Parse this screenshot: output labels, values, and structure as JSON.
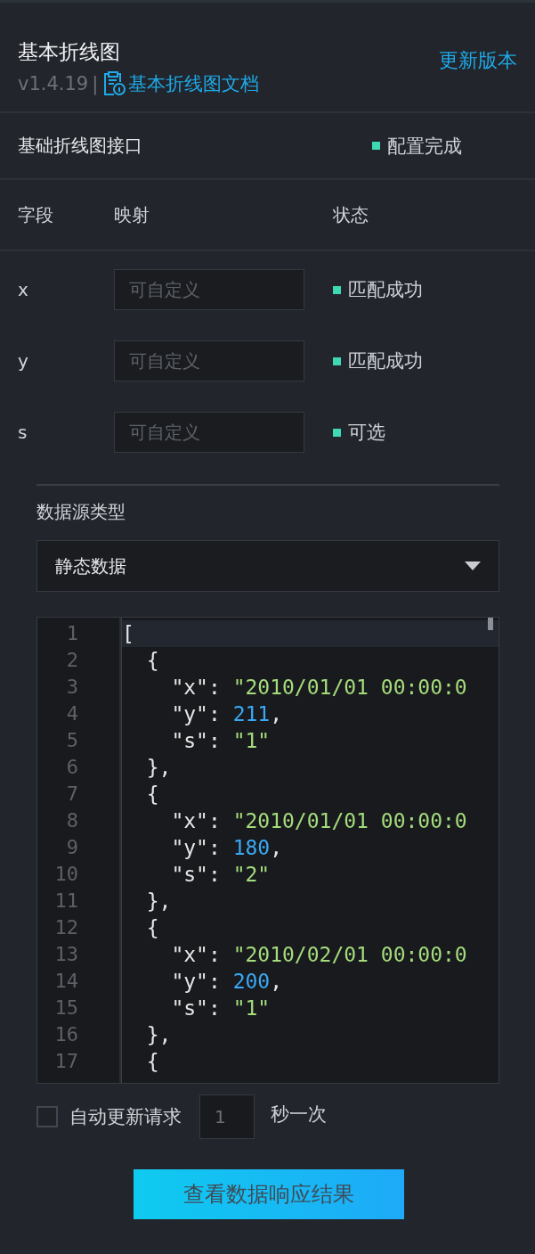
{
  "header": {
    "title": "基本折线图",
    "version": "v1.4.19",
    "separator": "|",
    "doc_link": "基本折线图文档",
    "update_link": "更新版本"
  },
  "interface": {
    "title": "基础折线图接口",
    "status": "配置完成"
  },
  "fields_table": {
    "columns": [
      "字段",
      "映射",
      "状态"
    ],
    "rows": [
      {
        "field": "x",
        "placeholder": "可自定义",
        "status": "匹配成功"
      },
      {
        "field": "y",
        "placeholder": "可自定义",
        "status": "匹配成功"
      },
      {
        "field": "s",
        "placeholder": "可自定义",
        "status": "可选"
      }
    ]
  },
  "data_source": {
    "label": "数据源类型",
    "dropdown": "静态数据"
  },
  "editor": {
    "lines": [
      {
        "number": "1",
        "current": true,
        "tokens": [
          {
            "kind": "plain",
            "text": "["
          }
        ]
      },
      {
        "number": "2",
        "current": false,
        "tokens": [
          {
            "kind": "plain",
            "text": "  {"
          }
        ]
      },
      {
        "number": "3",
        "current": false,
        "tokens": [
          {
            "kind": "plain",
            "text": "    \"x\": "
          },
          {
            "kind": "string",
            "text": "\"2010/01/01 00:00:0"
          }
        ]
      },
      {
        "number": "4",
        "current": false,
        "tokens": [
          {
            "kind": "plain",
            "text": "    \"y\": "
          },
          {
            "kind": "number",
            "text": "211"
          },
          {
            "kind": "plain",
            "text": ","
          }
        ]
      },
      {
        "number": "5",
        "current": false,
        "tokens": [
          {
            "kind": "plain",
            "text": "    \"s\": "
          },
          {
            "kind": "string",
            "text": "\"1\""
          }
        ]
      },
      {
        "number": "6",
        "current": false,
        "tokens": [
          {
            "kind": "plain",
            "text": "  },"
          }
        ]
      },
      {
        "number": "7",
        "current": false,
        "tokens": [
          {
            "kind": "plain",
            "text": "  {"
          }
        ]
      },
      {
        "number": "8",
        "current": false,
        "tokens": [
          {
            "kind": "plain",
            "text": "    \"x\": "
          },
          {
            "kind": "string",
            "text": "\"2010/01/01 00:00:0"
          }
        ]
      },
      {
        "number": "9",
        "current": false,
        "tokens": [
          {
            "kind": "plain",
            "text": "    \"y\": "
          },
          {
            "kind": "number",
            "text": "180"
          },
          {
            "kind": "plain",
            "text": ","
          }
        ]
      },
      {
        "number": "10",
        "current": false,
        "tokens": [
          {
            "kind": "plain",
            "text": "    \"s\": "
          },
          {
            "kind": "string",
            "text": "\"2\""
          }
        ]
      },
      {
        "number": "11",
        "current": false,
        "tokens": [
          {
            "kind": "plain",
            "text": "  },"
          }
        ]
      },
      {
        "number": "12",
        "current": false,
        "tokens": [
          {
            "kind": "plain",
            "text": "  {"
          }
        ]
      },
      {
        "number": "13",
        "current": false,
        "tokens": [
          {
            "kind": "plain",
            "text": "    \"x\": "
          },
          {
            "kind": "string",
            "text": "\"2010/02/01 00:00:0"
          }
        ]
      },
      {
        "number": "14",
        "current": false,
        "tokens": [
          {
            "kind": "plain",
            "text": "    \"y\": "
          },
          {
            "kind": "number",
            "text": "200"
          },
          {
            "kind": "plain",
            "text": ","
          }
        ]
      },
      {
        "number": "15",
        "current": false,
        "tokens": [
          {
            "kind": "plain",
            "text": "    \"s\": "
          },
          {
            "kind": "string",
            "text": "\"1\""
          }
        ]
      },
      {
        "number": "16",
        "current": false,
        "tokens": [
          {
            "kind": "plain",
            "text": "  },"
          }
        ]
      },
      {
        "number": "17",
        "current": false,
        "tokens": [
          {
            "kind": "plain",
            "text": "  {"
          }
        ]
      }
    ]
  },
  "auto_update": {
    "checked": false,
    "label": "自动更新请求",
    "interval": "1",
    "unit": "秒一次"
  },
  "view_button": "查看数据响应结果"
}
